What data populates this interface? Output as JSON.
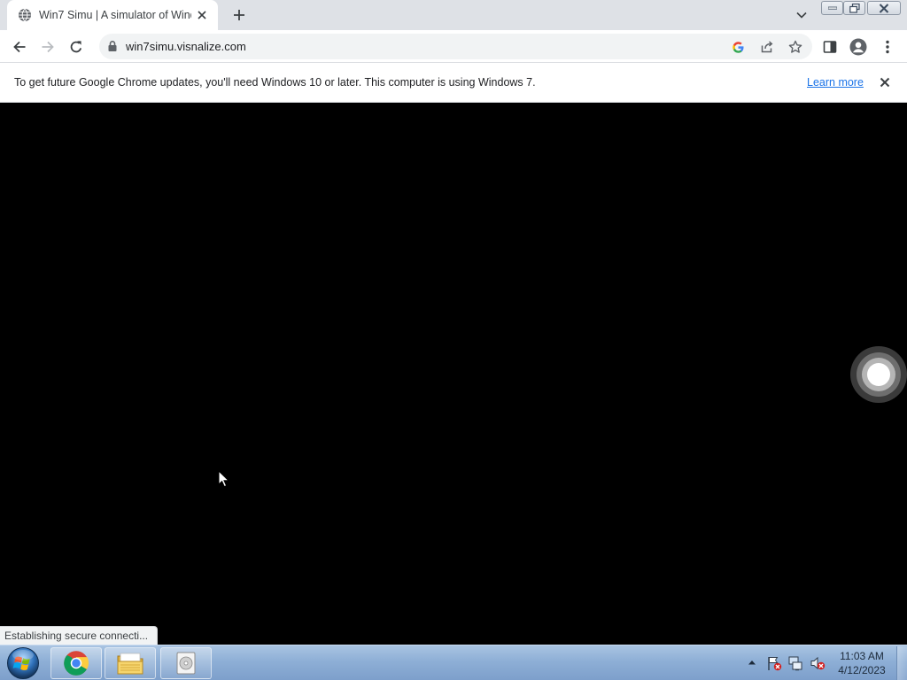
{
  "browser": {
    "tab": {
      "title": "Win7 Simu | A simulator of Windows 7",
      "favicon": "globe-icon"
    },
    "new_tab_icon": "plus-icon",
    "address": {
      "url": "win7simu.visnalize.com"
    },
    "colors": {
      "tab_strip": "#dee1e6",
      "omnibox": "#f1f3f4",
      "link": "#1a73e8"
    }
  },
  "infobar": {
    "message": "To get future Google Chrome updates, you'll need Windows 10 or later. This computer is using Windows 7.",
    "link": "Learn more"
  },
  "content": {
    "background": "#000000",
    "status": "Establishing secure connecti..."
  },
  "taskbar": {
    "clock": {
      "time": "11:03 AM",
      "date": "4/12/2023"
    },
    "apps": [
      "chrome-icon",
      "file-explorer-icon",
      "cd-player-icon"
    ],
    "tray": [
      "action-center-flag-icon",
      "network-icon",
      "volume-muted-icon"
    ]
  }
}
